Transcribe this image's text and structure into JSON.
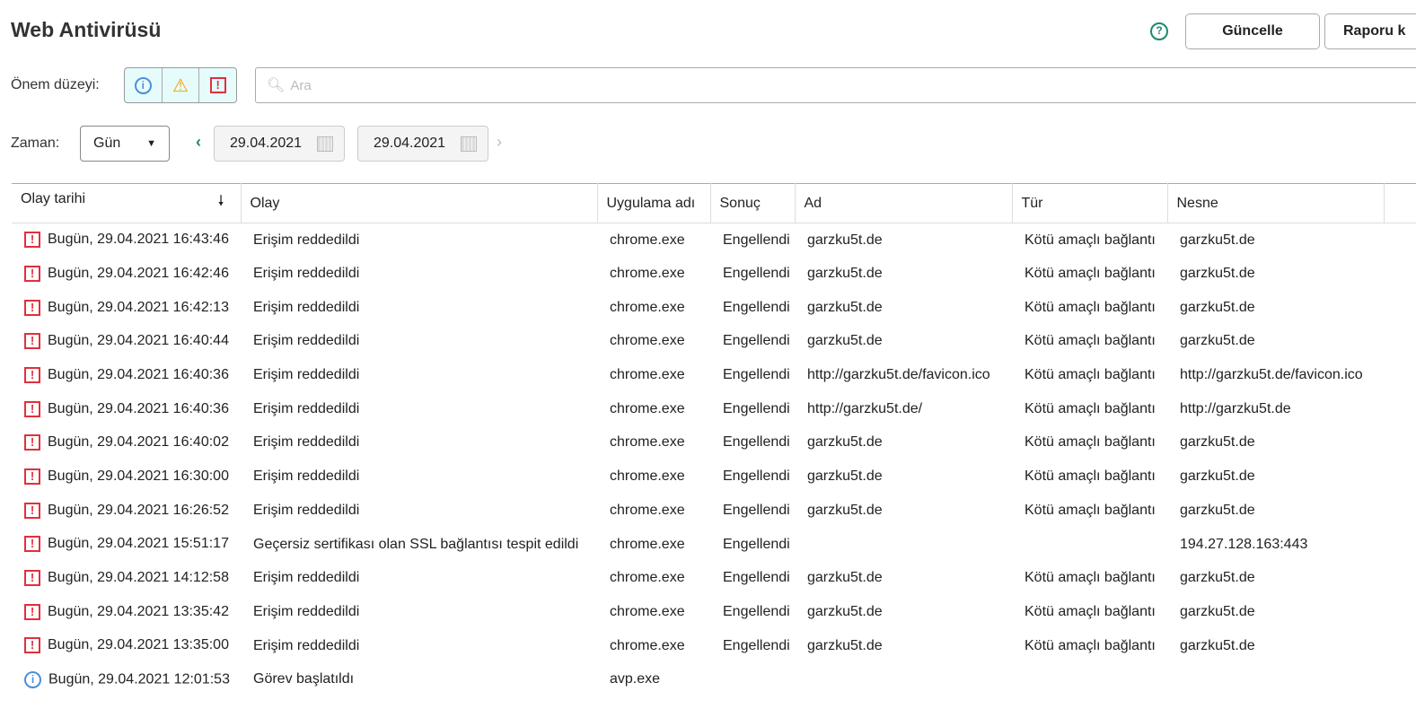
{
  "title": "Web Antivirüsü",
  "buttons": {
    "update": "Güncelle",
    "report": "Raporu k"
  },
  "filters": {
    "severity_label": "Önem düzeyi:",
    "search_placeholder": "Ara",
    "time_label": "Zaman:",
    "period": "Gün",
    "date_from": "29.04.2021",
    "date_to": "29.04.2021"
  },
  "columns": [
    "Olay tarihi",
    "Olay",
    "Uygulama adı",
    "Sonuç",
    "Ad",
    "Tür",
    "Nesne"
  ],
  "rows": [
    {
      "level": "error",
      "date": "Bugün, 29.04.2021 16:43:46",
      "event": "Erişim reddedildi",
      "app": "chrome.exe",
      "result": "Engellendi",
      "name": "garzku5t.de",
      "type": "Kötü amaçlı bağlantı",
      "object": "garzku5t.de"
    },
    {
      "level": "error",
      "date": "Bugün, 29.04.2021 16:42:46",
      "event": "Erişim reddedildi",
      "app": "chrome.exe",
      "result": "Engellendi",
      "name": "garzku5t.de",
      "type": "Kötü amaçlı bağlantı",
      "object": "garzku5t.de"
    },
    {
      "level": "error",
      "date": "Bugün, 29.04.2021 16:42:13",
      "event": "Erişim reddedildi",
      "app": "chrome.exe",
      "result": "Engellendi",
      "name": "garzku5t.de",
      "type": "Kötü amaçlı bağlantı",
      "object": "garzku5t.de"
    },
    {
      "level": "error",
      "date": "Bugün, 29.04.2021 16:40:44",
      "event": "Erişim reddedildi",
      "app": "chrome.exe",
      "result": "Engellendi",
      "name": "garzku5t.de",
      "type": "Kötü amaçlı bağlantı",
      "object": "garzku5t.de"
    },
    {
      "level": "error",
      "date": "Bugün, 29.04.2021 16:40:36",
      "event": "Erişim reddedildi",
      "app": "chrome.exe",
      "result": "Engellendi",
      "name": "http://garzku5t.de/favicon.ico",
      "type": "Kötü amaçlı bağlantı",
      "object": "http://garzku5t.de/favicon.ico"
    },
    {
      "level": "error",
      "date": "Bugün, 29.04.2021 16:40:36",
      "event": "Erişim reddedildi",
      "app": "chrome.exe",
      "result": "Engellendi",
      "name": "http://garzku5t.de/",
      "type": "Kötü amaçlı bağlantı",
      "object": "http://garzku5t.de"
    },
    {
      "level": "error",
      "date": "Bugün, 29.04.2021 16:40:02",
      "event": "Erişim reddedildi",
      "app": "chrome.exe",
      "result": "Engellendi",
      "name": "garzku5t.de",
      "type": "Kötü amaçlı bağlantı",
      "object": "garzku5t.de"
    },
    {
      "level": "error",
      "date": "Bugün, 29.04.2021 16:30:00",
      "event": "Erişim reddedildi",
      "app": "chrome.exe",
      "result": "Engellendi",
      "name": "garzku5t.de",
      "type": "Kötü amaçlı bağlantı",
      "object": "garzku5t.de"
    },
    {
      "level": "error",
      "date": "Bugün, 29.04.2021 16:26:52",
      "event": "Erişim reddedildi",
      "app": "chrome.exe",
      "result": "Engellendi",
      "name": "garzku5t.de",
      "type": "Kötü amaçlı bağlantı",
      "object": "garzku5t.de"
    },
    {
      "level": "error",
      "date": "Bugün, 29.04.2021 15:51:17",
      "event": "Geçersiz sertifikası olan SSL bağlantısı tespit edildi",
      "app": "chrome.exe",
      "result": "Engellendi",
      "name": "",
      "type": "",
      "object": "194.27.128.163:443"
    },
    {
      "level": "error",
      "date": "Bugün, 29.04.2021 14:12:58",
      "event": "Erişim reddedildi",
      "app": "chrome.exe",
      "result": "Engellendi",
      "name": "garzku5t.de",
      "type": "Kötü amaçlı bağlantı",
      "object": "garzku5t.de"
    },
    {
      "level": "error",
      "date": "Bugün, 29.04.2021 13:35:42",
      "event": "Erişim reddedildi",
      "app": "chrome.exe",
      "result": "Engellendi",
      "name": "garzku5t.de",
      "type": "Kötü amaçlı bağlantı",
      "object": "garzku5t.de"
    },
    {
      "level": "error",
      "date": "Bugün, 29.04.2021 13:35:00",
      "event": "Erişim reddedildi",
      "app": "chrome.exe",
      "result": "Engellendi",
      "name": "garzku5t.de",
      "type": "Kötü amaçlı bağlantı",
      "object": "garzku5t.de"
    },
    {
      "level": "info",
      "date": "Bugün, 29.04.2021 12:01:53",
      "event": "Görev başlatıldı",
      "app": "avp.exe",
      "result": "",
      "name": "",
      "type": "",
      "object": ""
    }
  ]
}
